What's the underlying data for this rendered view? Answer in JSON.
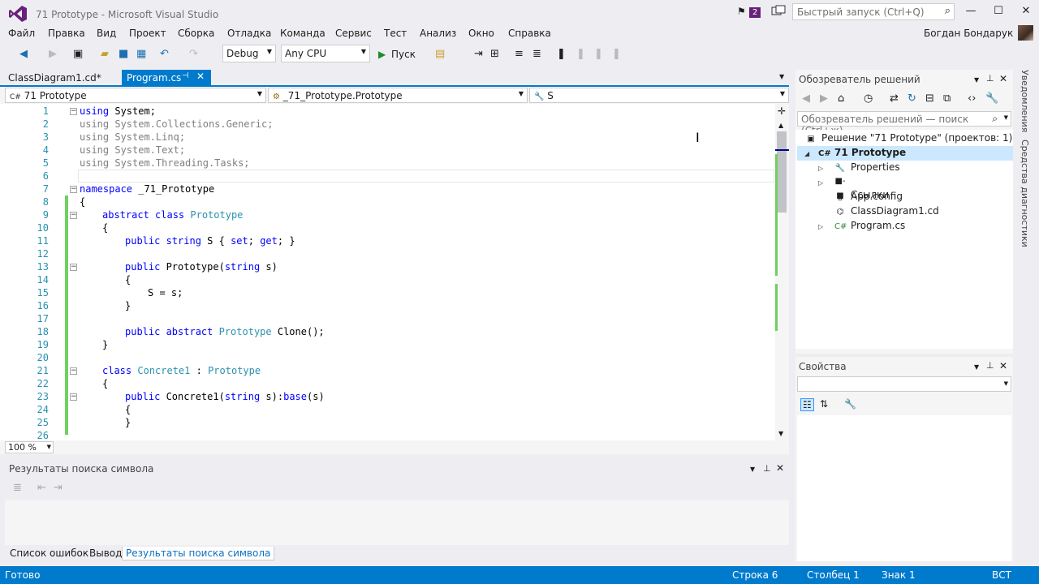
{
  "window": {
    "title": "71 Prototype - Microsoft Visual Studio",
    "notif_count": "2",
    "quick_launch_placeholder": "Быстрый запуск (Ctrl+Q)",
    "user": "Богдан Бондарук"
  },
  "menu": [
    "Файл",
    "Правка",
    "Вид",
    "Проект",
    "Сборка",
    "Отладка",
    "Команда",
    "Сервис",
    "Тест",
    "Анализ",
    "Окно",
    "Справка"
  ],
  "toolbar": {
    "config": "Debug",
    "platform": "Any CPU",
    "start_label": "Пуск"
  },
  "tabs": {
    "tab1": "ClassDiagram1.cd*",
    "tab2": "Program.cs"
  },
  "navbar": {
    "project": "71 Prototype",
    "type": "_71_Prototype.Prototype",
    "member": "S"
  },
  "code": {
    "lines": [
      "1",
      "2",
      "3",
      "4",
      "5",
      "6",
      "7",
      "8",
      "9",
      "10",
      "11",
      "12",
      "13",
      "14",
      "15",
      "16",
      "17",
      "18",
      "19",
      "20",
      "21",
      "22",
      "23",
      "24",
      "25",
      "26"
    ],
    "l1": [
      "using",
      " System;"
    ],
    "l2": "using System.Collections.Generic;",
    "l3": "using System.Linq;",
    "l4": "using System.Text;",
    "l5": "using System.Threading.Tasks;",
    "l7": [
      "namespace",
      " _71_Prototype"
    ],
    "l8": "{",
    "l9": [
      "abstract class ",
      "Prototype"
    ],
    "l10": "{",
    "l11": [
      "public string ",
      "S { ",
      "set",
      "; ",
      "get",
      "; }"
    ],
    "l13": [
      "public ",
      "Prototype(",
      "string",
      " s)"
    ],
    "l14": "{",
    "l15": "S = s;",
    "l16": "}",
    "l18": [
      "public abstract ",
      "Prototype",
      " Clone();"
    ],
    "l19": "}",
    "l21": [
      "class ",
      "Concrete1",
      " : ",
      "Prototype"
    ],
    "l22": "{",
    "l23": [
      "public ",
      "Concrete1(",
      "string",
      " s):",
      "base",
      "(s)"
    ],
    "l24": "{",
    "l25": "}"
  },
  "zoom": "100 %",
  "lower_panel": {
    "title": "Результаты поиска символа"
  },
  "bottom_tabs": [
    "Список ошибок",
    "Вывод",
    "Результаты поиска символа"
  ],
  "status": {
    "ready": "Готово",
    "line": "Строка 6",
    "col": "Столбец 1",
    "char": "Знак 1",
    "mode": "ВСТ"
  },
  "solution_explorer": {
    "title": "Обозреватель решений",
    "search_placeholder": "Обозреватель решений — поиск (Ctrl+ж)",
    "items": [
      "Решение \"71 Prototype\" (проектов: 1)",
      "71 Prototype",
      "Properties",
      "Ссылки",
      "App.config",
      "ClassDiagram1.cd",
      "Program.cs"
    ]
  },
  "properties": {
    "title": "Свойства"
  },
  "side_tabs": [
    "Уведомления",
    "Средства диагностики"
  ]
}
